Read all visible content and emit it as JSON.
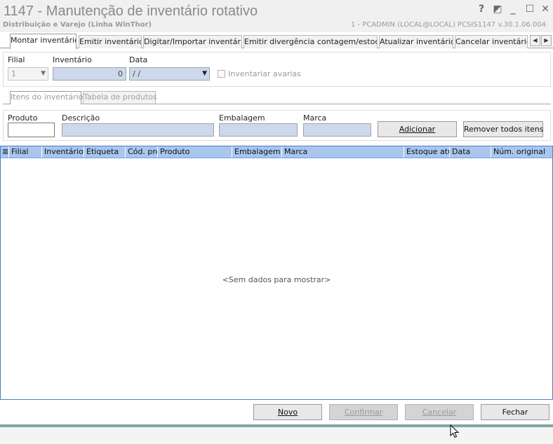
{
  "window": {
    "title": "1147 - Manutenção de inventário rotativo",
    "subtitle": "Distribuição e Varejo (Linha WinThor)",
    "session_info": "1 - PCADMIN (LOCAL@LOCAL)   PCSIS1147  v.30.1.06.004",
    "controls": {
      "help": "?",
      "restore": "◩",
      "minimize": "_",
      "maximize": "☐",
      "close": "✕"
    }
  },
  "tabs": [
    {
      "label": "Montar inventário"
    },
    {
      "label": "Emitir inventário"
    },
    {
      "label": "Digitar/Importar inventário"
    },
    {
      "label": "Emitir divergência contagem/estoque"
    },
    {
      "label": "Atualizar inventário"
    },
    {
      "label": "Cancelar inventário"
    }
  ],
  "tab_scroll": {
    "left": "◀",
    "right": "▶"
  },
  "filter": {
    "filial_label": "Filial",
    "filial_value": "1",
    "inventario_label": "Inventário",
    "inventario_value": "0",
    "data_label": "Data",
    "data_value": " / /",
    "avarias_label": "Inventariar avarias"
  },
  "subtabs": [
    {
      "label": "Itens do inventário"
    },
    {
      "label": "Tabela de produtos"
    }
  ],
  "product": {
    "produto_label": "Produto",
    "produto_value": "",
    "descricao_label": "Descrição",
    "embalagem_label": "Embalagem",
    "marca_label": "Marca",
    "adicionar_label": "Adicionar",
    "remover_label": "Remover todos itens"
  },
  "grid": {
    "columns": [
      "Filial",
      "Inventário",
      "Etiqueta",
      "Cód. pro",
      "Produto",
      "Embalagem",
      "Marca",
      "Estoque atua",
      "Data",
      "Núm. original"
    ],
    "empty_text": "<Sem dados para mostrar>"
  },
  "footer": {
    "novo": "Novo",
    "confirmar": "Confirmar",
    "cancelar": "Cancelar",
    "fechar": "Fechar"
  }
}
